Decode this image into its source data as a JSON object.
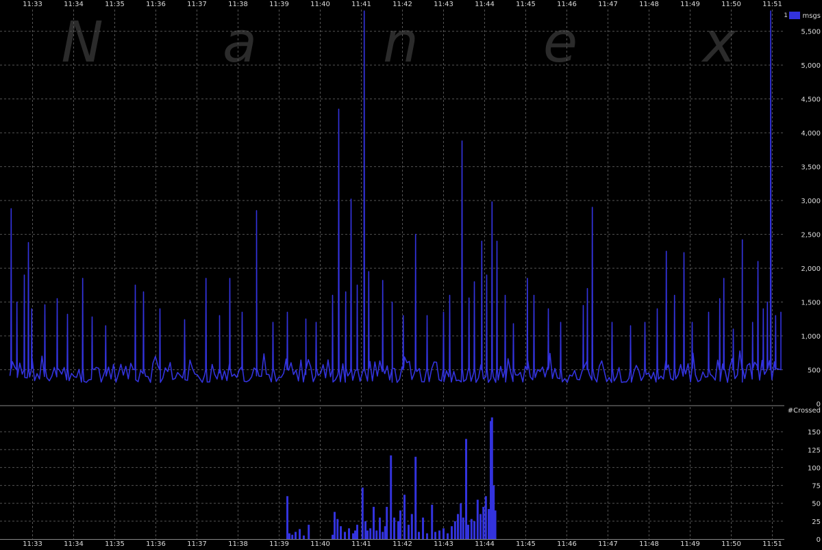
{
  "chart_data": [
    {
      "type": "line",
      "panel": "upper",
      "watermark": "Nanex",
      "ylabel": "msgs",
      "legend": {
        "label": "1",
        "placement": "top-right",
        "color": "#3333dd"
      },
      "ylim": [
        0,
        5800
      ],
      "yticks": [
        0,
        500,
        1000,
        1500,
        2000,
        2500,
        3000,
        3500,
        4000,
        4500,
        5000,
        5500
      ],
      "ytick_labels": [
        "0",
        "500",
        "1,000",
        "1,500",
        "2,000",
        "2,500",
        "3,000",
        "3,500",
        "4,000",
        "4,500",
        "5,000",
        "5,500"
      ],
      "xticks": [
        "11:33",
        "11:34",
        "11:35",
        "11:36",
        "11:37",
        "11:38",
        "11:39",
        "11:40",
        "11:41",
        "11:42",
        "11:43",
        "11:44",
        "11:45",
        "11:46",
        "11:47",
        "11:48",
        "11:49",
        "11:50",
        "11:51"
      ],
      "x_unit": "minutes after 11:33",
      "x_range": [
        -0.55,
        18.2
      ],
      "grid": true,
      "series": [
        {
          "color": "#3333dd",
          "baseline": {
            "start": -0.55,
            "end": 18.05,
            "step": 0.06,
            "low": 150,
            "high": 800
          },
          "spikes": [
            [
              -0.52,
              2880
            ],
            [
              -0.38,
              1500
            ],
            [
              -0.2,
              1900
            ],
            [
              -0.1,
              2380
            ],
            [
              -0.02,
              1400
            ],
            [
              0.3,
              1460
            ],
            [
              0.6,
              1550
            ],
            [
              0.85,
              1320
            ],
            [
              1.22,
              1850
            ],
            [
              1.45,
              1280
            ],
            [
              1.78,
              1150
            ],
            [
              2.5,
              1750
            ],
            [
              2.7,
              1650
            ],
            [
              3.1,
              1400
            ],
            [
              3.7,
              1240
            ],
            [
              4.22,
              1850
            ],
            [
              4.55,
              1300
            ],
            [
              4.8,
              1850
            ],
            [
              5.1,
              1350
            ],
            [
              5.45,
              2850
            ],
            [
              5.85,
              1200
            ],
            [
              6.2,
              1350
            ],
            [
              6.65,
              1250
            ],
            [
              6.9,
              1200
            ],
            [
              7.3,
              1600
            ],
            [
              7.45,
              4350
            ],
            [
              7.62,
              1650
            ],
            [
              7.75,
              3020
            ],
            [
              7.9,
              1750
            ],
            [
              8.07,
              5820
            ],
            [
              8.18,
              1950
            ],
            [
              8.52,
              1820
            ],
            [
              8.75,
              1500
            ],
            [
              9.02,
              1300
            ],
            [
              9.32,
              2500
            ],
            [
              9.6,
              1300
            ],
            [
              10.0,
              1350
            ],
            [
              10.15,
              1600
            ],
            [
              10.45,
              3880
            ],
            [
              10.62,
              1560
            ],
            [
              10.75,
              1800
            ],
            [
              10.93,
              2400
            ],
            [
              11.05,
              1900
            ],
            [
              11.18,
              2980
            ],
            [
              11.3,
              2400
            ],
            [
              11.5,
              1600
            ],
            [
              11.7,
              1180
            ],
            [
              12.04,
              1850
            ],
            [
              12.2,
              1600
            ],
            [
              12.55,
              1400
            ],
            [
              12.85,
              1200
            ],
            [
              13.4,
              1450
            ],
            [
              13.5,
              1700
            ],
            [
              13.62,
              2900
            ],
            [
              14.1,
              1200
            ],
            [
              14.55,
              1150
            ],
            [
              14.9,
              1200
            ],
            [
              15.2,
              1400
            ],
            [
              15.42,
              2250
            ],
            [
              15.62,
              1600
            ],
            [
              15.85,
              2230
            ],
            [
              16.05,
              1200
            ],
            [
              16.45,
              1350
            ],
            [
              16.72,
              1550
            ],
            [
              16.82,
              1850
            ],
            [
              17.05,
              1100
            ],
            [
              17.27,
              2420
            ],
            [
              17.52,
              1200
            ],
            [
              17.65,
              2100
            ],
            [
              17.78,
              1400
            ],
            [
              17.88,
              1500
            ],
            [
              17.96,
              5820
            ],
            [
              18.08,
              1300
            ],
            [
              18.25,
              1200
            ],
            [
              18.32,
              1350
            ]
          ]
        }
      ]
    },
    {
      "type": "bar",
      "panel": "lower",
      "ylabel": "#Crossed",
      "ylim": [
        0,
        175
      ],
      "yticks": [
        0,
        25,
        50,
        75,
        100,
        125,
        150
      ],
      "ytick_labels": [
        "0",
        "25",
        "50",
        "75",
        "100",
        "125",
        "150"
      ],
      "xticks": [
        "11:33",
        "11:34",
        "11:35",
        "11:36",
        "11:37",
        "11:38",
        "11:39",
        "11:40",
        "11:41",
        "11:42",
        "11:43",
        "11:44",
        "11:45",
        "11:46",
        "11:47",
        "11:48",
        "11:49",
        "11:50",
        "11:51"
      ],
      "x_unit": "minutes after 11:33",
      "grid": true,
      "series": [
        {
          "color": "#3333dd",
          "bars": [
            [
              6.2,
              60
            ],
            [
              6.25,
              8
            ],
            [
              6.32,
              6
            ],
            [
              6.4,
              10
            ],
            [
              6.5,
              14
            ],
            [
              6.6,
              5
            ],
            [
              6.72,
              20
            ],
            [
              7.3,
              6
            ],
            [
              7.35,
              38
            ],
            [
              7.42,
              28
            ],
            [
              7.5,
              18
            ],
            [
              7.6,
              10
            ],
            [
              7.7,
              15
            ],
            [
              7.8,
              8
            ],
            [
              7.85,
              12
            ],
            [
              7.9,
              20
            ],
            [
              8.03,
              72
            ],
            [
              8.1,
              25
            ],
            [
              8.15,
              12
            ],
            [
              8.22,
              15
            ],
            [
              8.3,
              45
            ],
            [
              8.37,
              12
            ],
            [
              8.45,
              30
            ],
            [
              8.52,
              10
            ],
            [
              8.58,
              18
            ],
            [
              8.62,
              45
            ],
            [
              8.72,
              117
            ],
            [
              8.8,
              30
            ],
            [
              8.9,
              25
            ],
            [
              8.95,
              40
            ],
            [
              9.05,
              62
            ],
            [
              9.15,
              20
            ],
            [
              9.23,
              35
            ],
            [
              9.32,
              115
            ],
            [
              9.4,
              10
            ],
            [
              9.5,
              30
            ],
            [
              9.6,
              8
            ],
            [
              9.72,
              48
            ],
            [
              9.8,
              10
            ],
            [
              9.9,
              12
            ],
            [
              10.0,
              15
            ],
            [
              10.1,
              8
            ],
            [
              10.2,
              18
            ],
            [
              10.28,
              25
            ],
            [
              10.35,
              35
            ],
            [
              10.42,
              50
            ],
            [
              10.48,
              30
            ],
            [
              10.55,
              140
            ],
            [
              10.6,
              20
            ],
            [
              10.68,
              28
            ],
            [
              10.75,
              25
            ],
            [
              10.83,
              55
            ],
            [
              10.9,
              35
            ],
            [
              10.97,
              45
            ],
            [
              11.03,
              60
            ],
            [
              11.1,
              42
            ],
            [
              11.15,
              165
            ],
            [
              11.18,
              170
            ],
            [
              11.22,
              75
            ],
            [
              11.26,
              40
            ]
          ]
        }
      ]
    }
  ]
}
